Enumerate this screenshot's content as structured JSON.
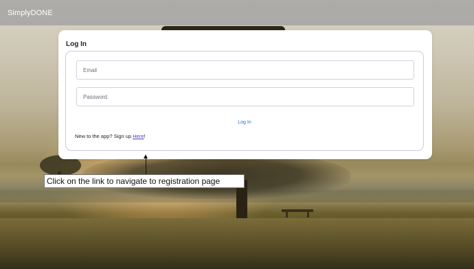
{
  "navbar": {
    "brand": "SimplyDONE"
  },
  "login_card": {
    "title": "Log In",
    "email_placeholder": "Email",
    "password_placeholder": "Password",
    "login_button": "Log In",
    "signup_prompt": "New to the app? Sign up ",
    "signup_link": "Here",
    "signup_suffix": "!"
  },
  "annotation": {
    "text": "Click on the link to navigate to registration page"
  },
  "colors": {
    "navbar_bg": "#a0a0a0",
    "link_blue": "#2f6fc9",
    "signup_link": "#4a3cc7",
    "card_border": "#c9cbe0"
  },
  "icons": {
    "annotation_arrow": "up-arrow-icon"
  }
}
